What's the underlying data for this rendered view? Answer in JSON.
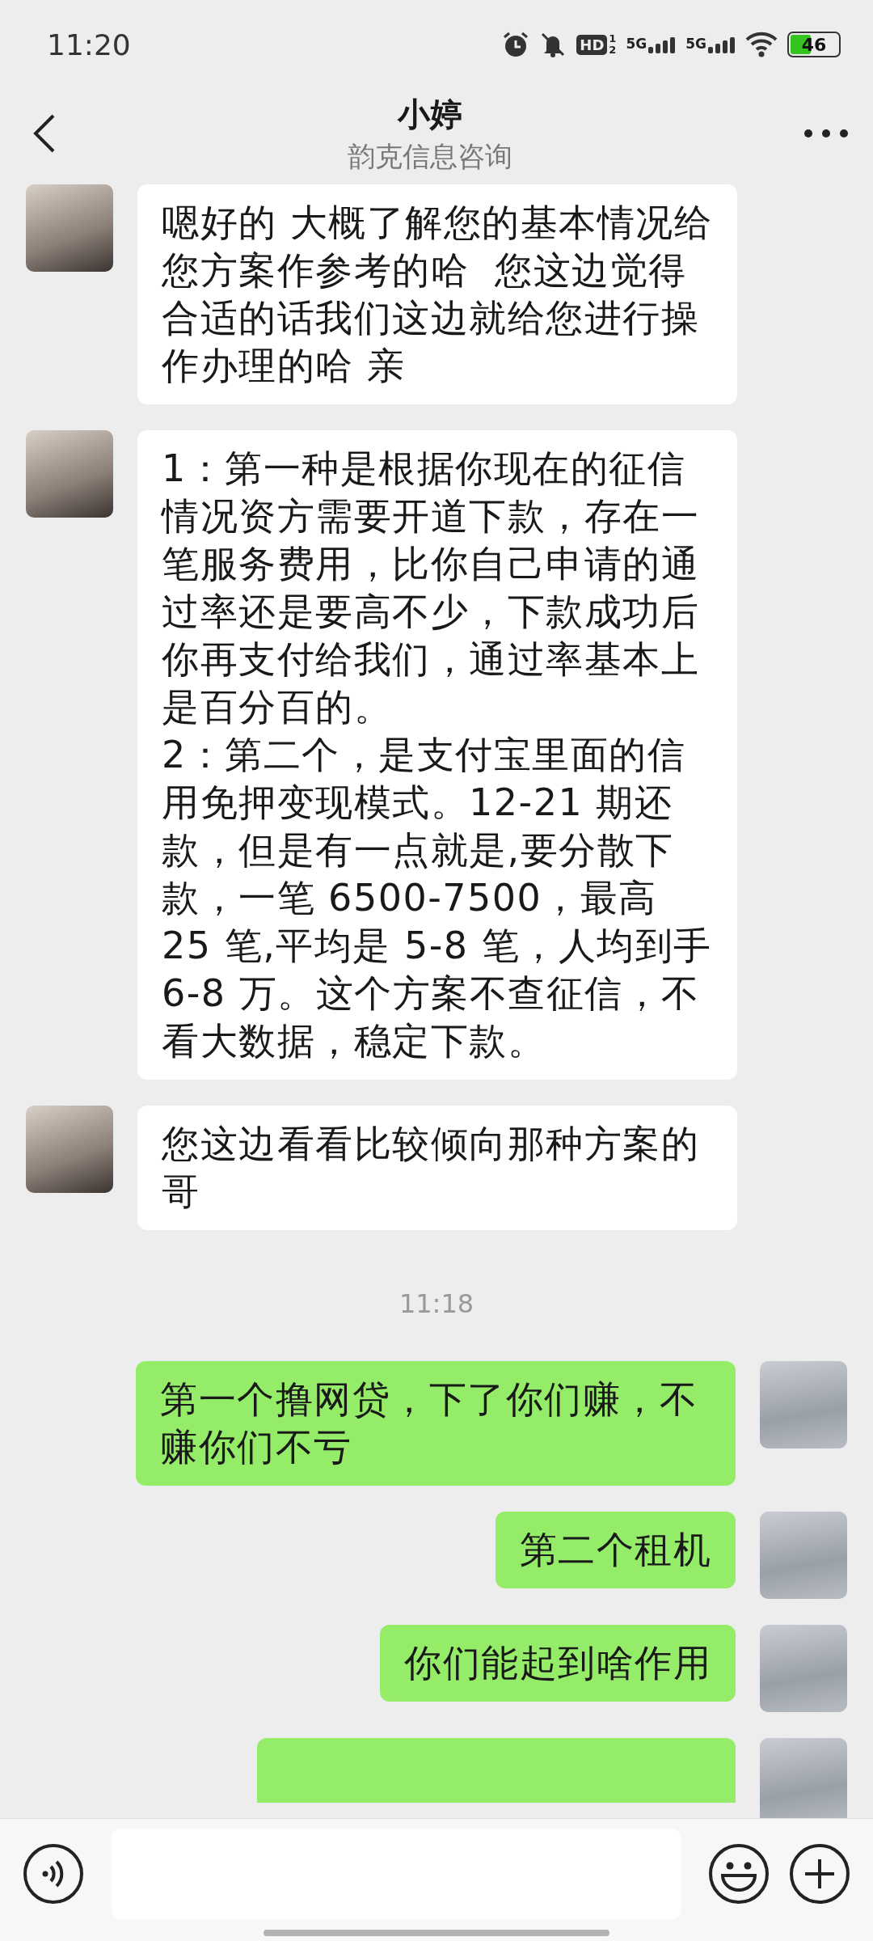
{
  "status_bar": {
    "time": "11:20",
    "hd": {
      "label": "HD",
      "slots": [
        "1",
        "2"
      ]
    },
    "networks": [
      "5G",
      "5G"
    ],
    "battery": {
      "level": 0.46,
      "text": "46"
    }
  },
  "header": {
    "title": "小婷",
    "subtitle": "韵克信息咨询"
  },
  "messages": [
    {
      "kind": "received",
      "text": "嗯好的 大概了解您的基本情况给您方案作参考的哈  您这边觉得合适的话我们这边就给您进行操作办理的哈 亲"
    },
    {
      "kind": "received",
      "text": "1：第一种是根据你现在的征信情况资方需要开道下款，存在一笔服务费用，比你自己申请的通过率还是要高不少，下款成功后你再支付给我们，通过率基本上是百分百的。\n2：第二个，是支付宝里面的信用免押变现模式。12-21 期还款，但是有一点就是,要分散下款，一笔 6500-7500，最高 25 笔,平均是 5-8 笔，人均到手 6-8 万。这个方案不查征信，不看大数据，稳定下款。"
    },
    {
      "kind": "received",
      "text": "您这边看看比较倾向那种方案的哥"
    },
    {
      "kind": "time",
      "text": "11:18"
    },
    {
      "kind": "sent",
      "text": "第一个撸网贷，下了你们赚，不赚你们不亏"
    },
    {
      "kind": "sent",
      "text": "第二个租机"
    },
    {
      "kind": "sent",
      "text": "你们能起到啥作用"
    },
    {
      "kind": "sent_cut"
    }
  ]
}
